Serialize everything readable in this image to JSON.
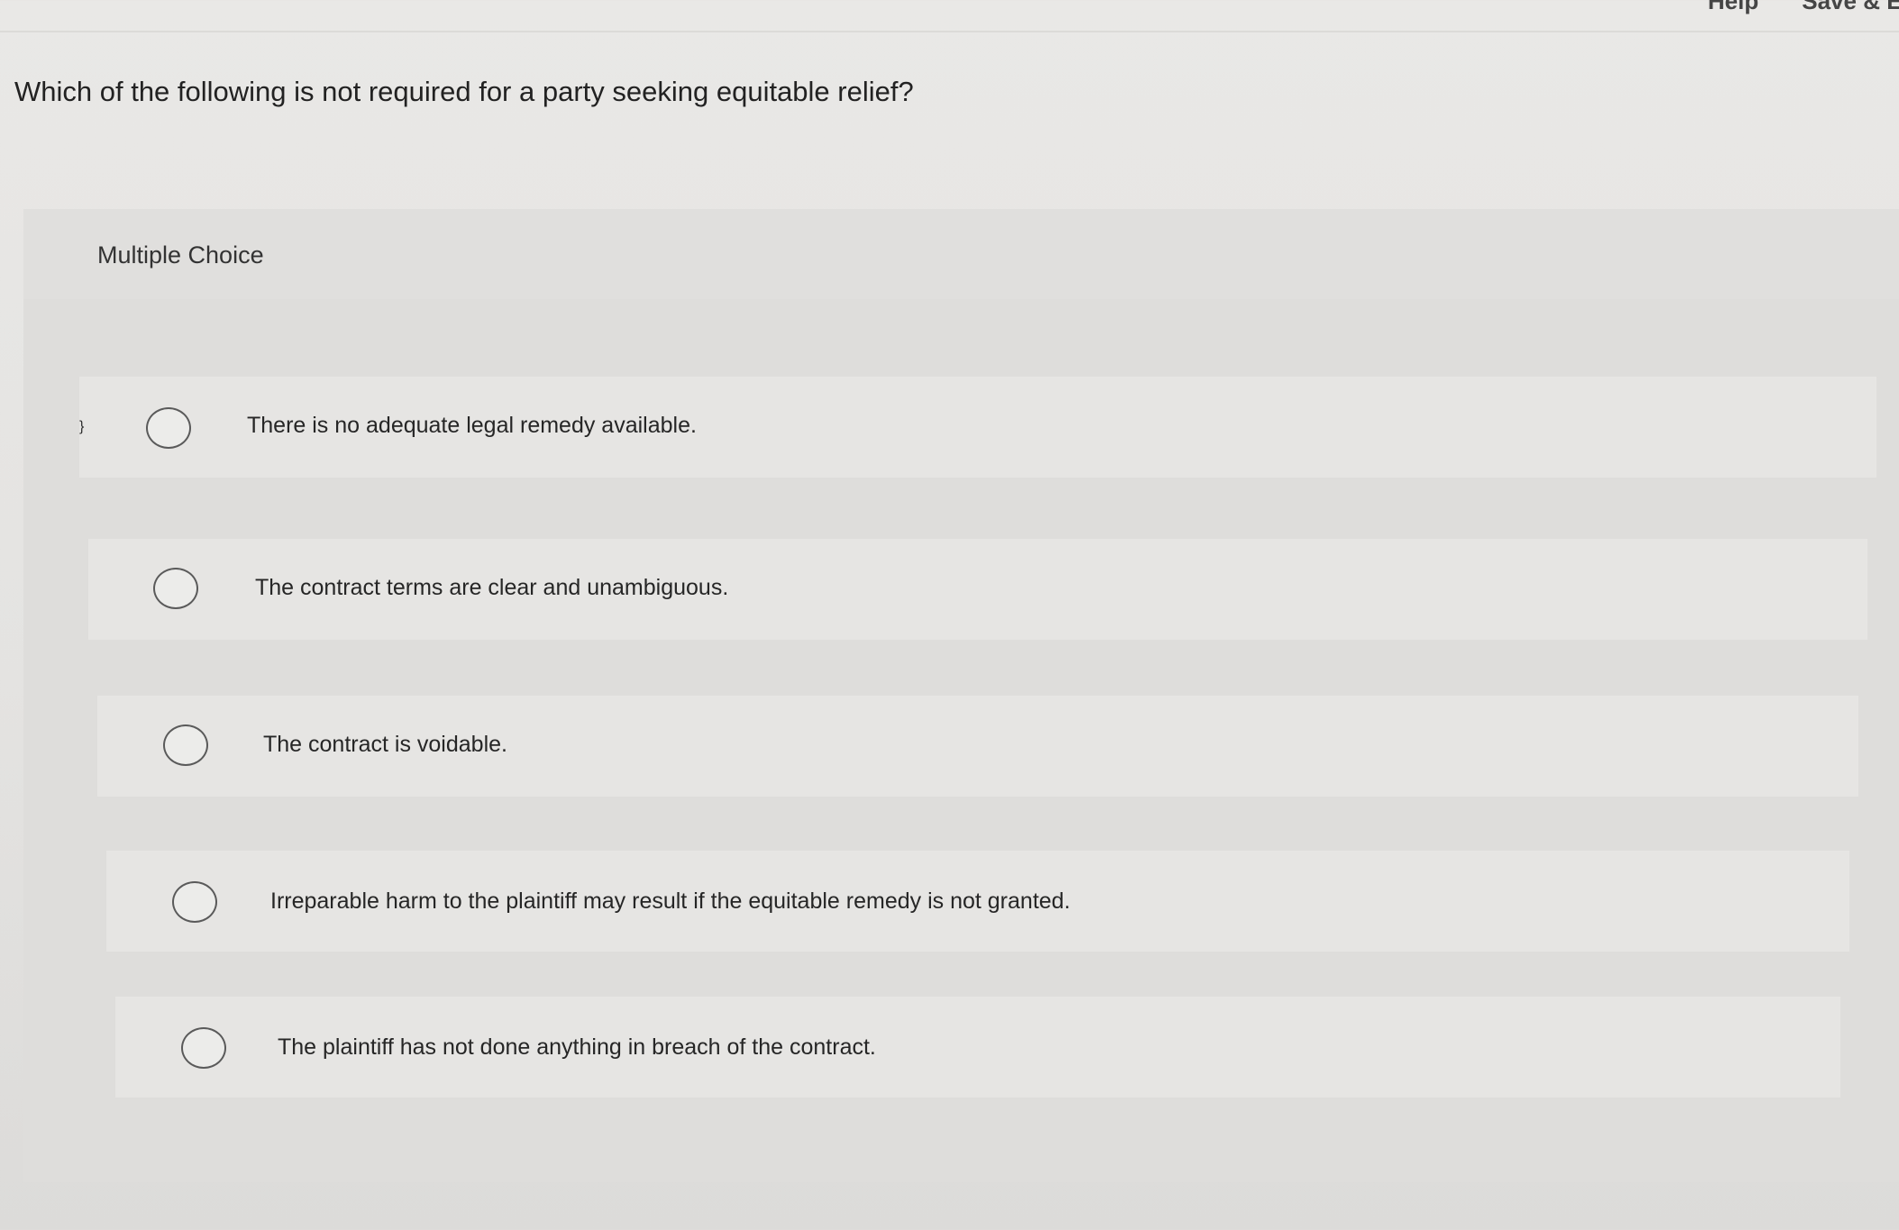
{
  "header": {
    "help_label": "Help",
    "save_exit_label": "Save & Ex"
  },
  "question": {
    "text": "Which of the following is not required for a party seeking equitable relief?",
    "type_label": "Multiple Choice"
  },
  "choices": [
    {
      "label": "There is no adequate legal remedy available.",
      "selected": false
    },
    {
      "label": "The contract terms are clear and unambiguous.",
      "selected": false
    },
    {
      "label": "The contract is voidable.",
      "selected": false
    },
    {
      "label": "Irreparable harm to the plaintiff may result if the equitable remedy is not granted.",
      "selected": false
    },
    {
      "label": "The plaintiff has not done anything in breach of the contract.",
      "selected": false
    }
  ],
  "icons": {
    "radio": "radio-unselected-icon"
  }
}
